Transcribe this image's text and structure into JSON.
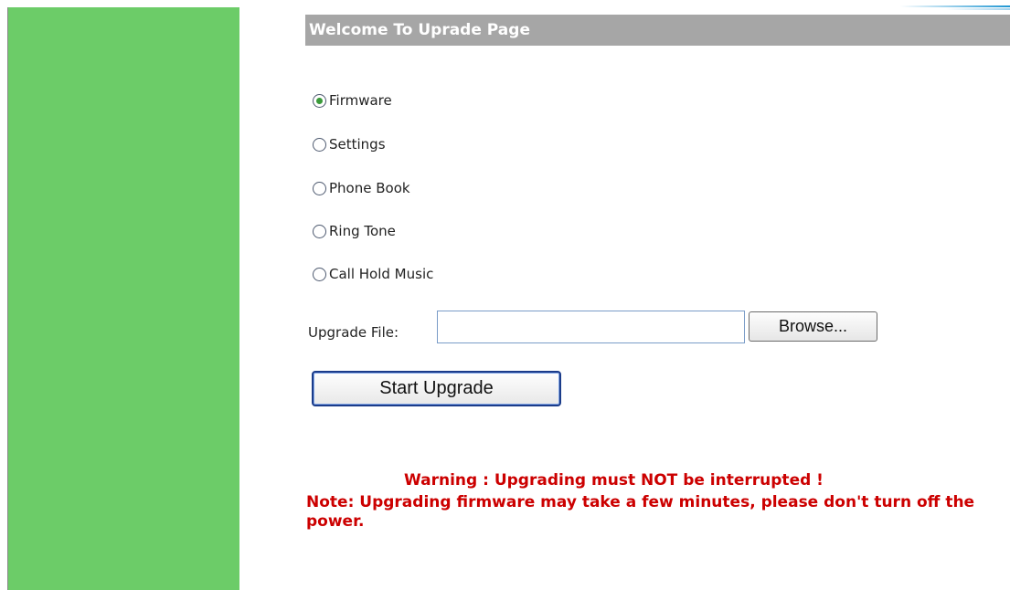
{
  "header": {
    "title": "Welcome To Uprade Page"
  },
  "upgrade_types": [
    {
      "label": "Firmware",
      "checked": true
    },
    {
      "label": "Settings",
      "checked": false
    },
    {
      "label": "Phone Book",
      "checked": false
    },
    {
      "label": "Ring Tone",
      "checked": false
    },
    {
      "label": "Call Hold Music",
      "checked": false
    }
  ],
  "file": {
    "label": "Upgrade File:",
    "value": "",
    "browse_label": "Browse..."
  },
  "actions": {
    "start_label": "Start Upgrade"
  },
  "messages": {
    "warning": "Warning : Upgrading must NOT be interrupted !",
    "note": "Note: Upgrading firmware may take a few minutes, please don't turn off the power."
  },
  "colors": {
    "sidebar": "#6ccc68",
    "title_bar": "#a6a6a6",
    "warning_text": "#cc0000",
    "selected_radio": "#3a9a3a"
  }
}
